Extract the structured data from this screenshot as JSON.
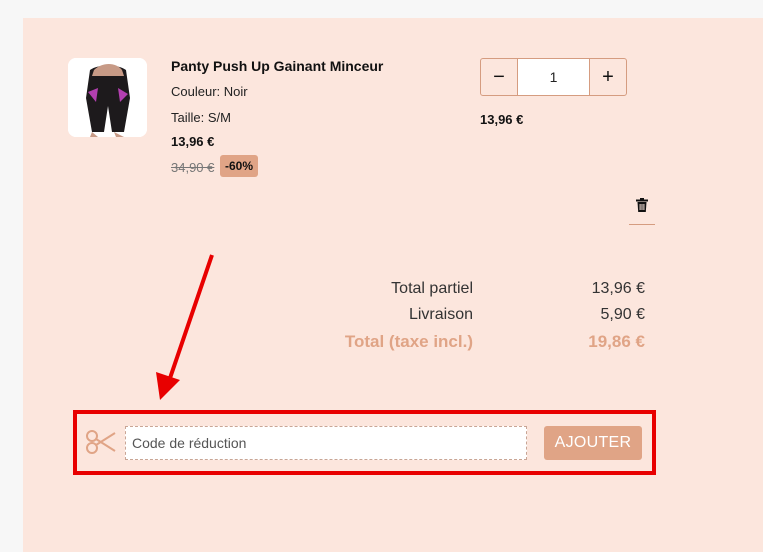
{
  "product": {
    "name": "Panty Push Up Gainant Minceur",
    "color": "Couleur: Noir",
    "size": "Taille: S/M",
    "price": "13,96 €",
    "old_price": "34,90 €",
    "discount": "-60%",
    "quantity": "1",
    "line_total": "13,96 €"
  },
  "quantity_controls": {
    "minus": "−",
    "plus": "+"
  },
  "summary": {
    "subtotal_label": "Total partiel",
    "subtotal_value": "13,96 €",
    "shipping_label": "Livraison",
    "shipping_value": "5,90 €",
    "total_label": "Total (taxe incl.)",
    "total_value": "19,86 €"
  },
  "voucher": {
    "placeholder": "Code de réduction",
    "button_label": "AJOUTER"
  },
  "colors": {
    "panel_bg": "#fce6dd",
    "accent": "#e0a486",
    "highlight_red": "#e80000"
  },
  "icons": [
    "trash-icon",
    "scissors-icon",
    "red-arrow"
  ]
}
